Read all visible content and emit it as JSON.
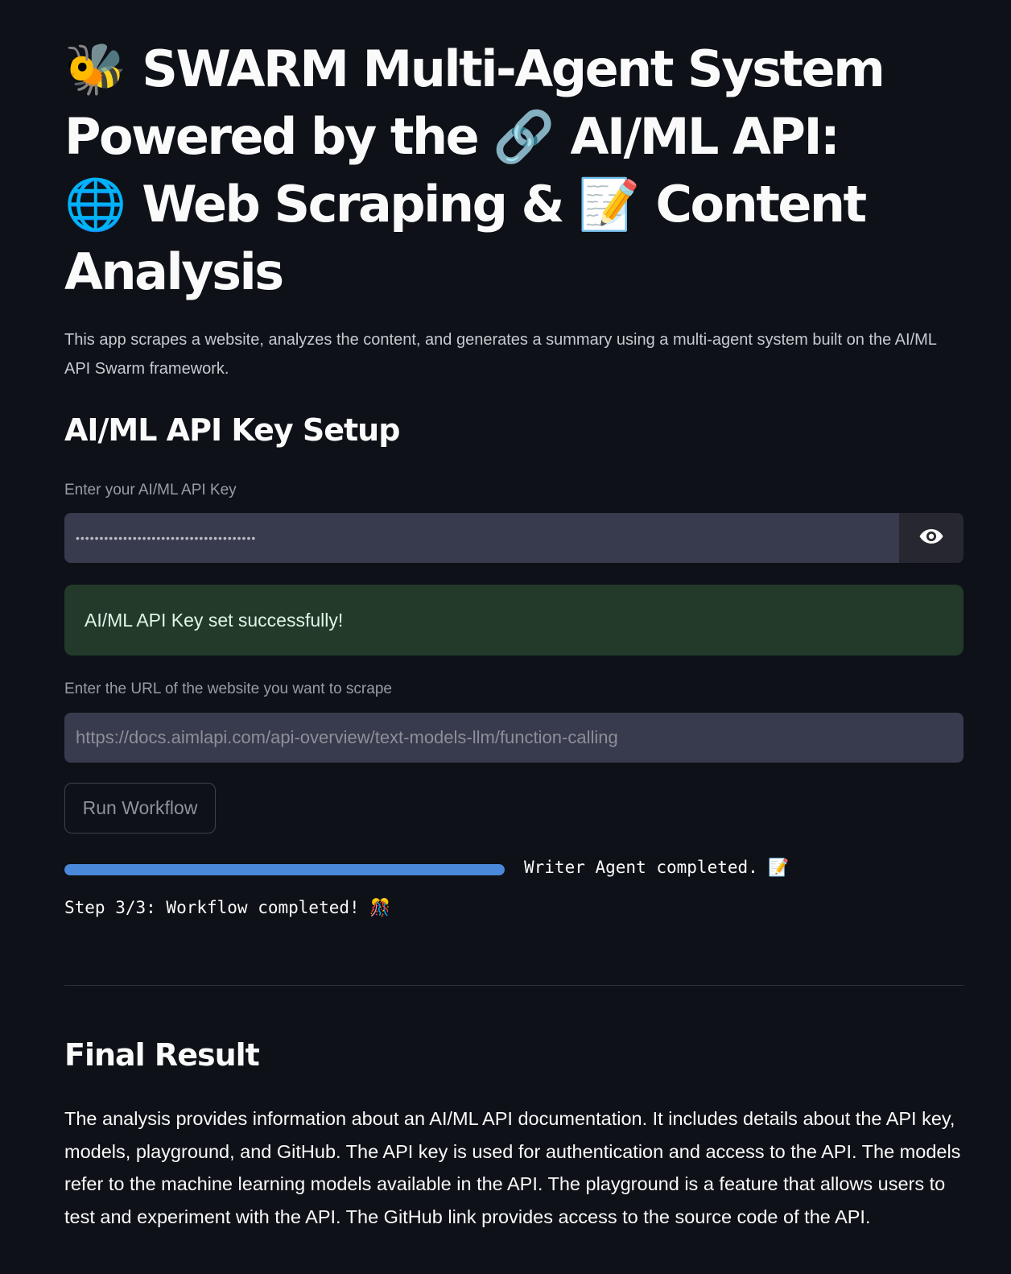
{
  "header": {
    "title_parts": {
      "bee_emoji": "🐝",
      "line1_text": " SWARM Multi-Agent System",
      "line2_text_a": "Powered by the ",
      "link_emoji": "🔗",
      "line2_text_b": " AI/ML API:",
      "globe_emoji": "🌐",
      "line3_text_a": " Web Scraping & ",
      "memo_emoji": "📝",
      "line3_text_b": " Content",
      "line4_text": "Analysis"
    },
    "description": "This app scrapes a website, analyzes the content, and generates a summary using a multi-agent system built on the AI/ML API Swarm framework."
  },
  "api_setup": {
    "heading": "AI/ML API Key Setup",
    "key_label": "Enter your AI/ML API Key",
    "key_value": "••••••••••••••••••••••••••••••••••••••",
    "show_password_icon": "eye-icon",
    "success_message": "AI/ML API Key set successfully!"
  },
  "url_input": {
    "label": "Enter the URL of the website you want to scrape",
    "placeholder": "https://docs.aimlapi.com/api-overview/text-models-llm/function-calling"
  },
  "run_button_label": "Run Workflow",
  "progress": {
    "fraction": 1.0,
    "bar_color": "#4a88d9",
    "status_text": "Writer Agent completed. 📝",
    "step_text": "Step 3/3: Workflow completed! 🎊"
  },
  "final_result": {
    "heading": "Final Result",
    "text": "The analysis provides information about an AI/ML API documentation. It includes details about the API key, models, playground, and GitHub. The API key is used for authentication and access to the API. The models refer to the machine learning models available in the API. The playground is a feature that allows users to test and experiment with the API. The GitHub link provides access to the source code of the API."
  },
  "colors": {
    "background": "#0e1117",
    "success_background": "#233a2b",
    "input_background": "#383b4d"
  }
}
